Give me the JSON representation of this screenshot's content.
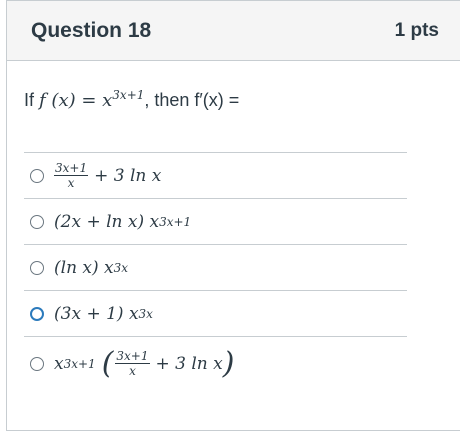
{
  "question": {
    "title": "Question 18",
    "points": "1 pts",
    "prompt_prefix": "If",
    "prompt_func": "f (x) = x",
    "prompt_exp": "3x+1",
    "prompt_suffix": ", then f′(x) ="
  },
  "answers": [
    {
      "frac_num": "3x+1",
      "frac_den": "x",
      "rest": "+ 3 ln x"
    },
    {
      "base": "(2x + ln x) x",
      "exp": "3x+1"
    },
    {
      "base": "(ln x) x",
      "exp": "3x"
    },
    {
      "base": "(3x + 1) x",
      "exp": "3x"
    },
    {
      "pre": "x",
      "pre_exp": "3x+1",
      "frac_num": "3x+1",
      "frac_den": "x",
      "rest": "+ 3 ln x"
    }
  ],
  "colors": {
    "focus_ring": "#2b7abc",
    "border": "#c7cdd1",
    "header_bg": "#f5f5f5",
    "text": "#2d3b45"
  }
}
